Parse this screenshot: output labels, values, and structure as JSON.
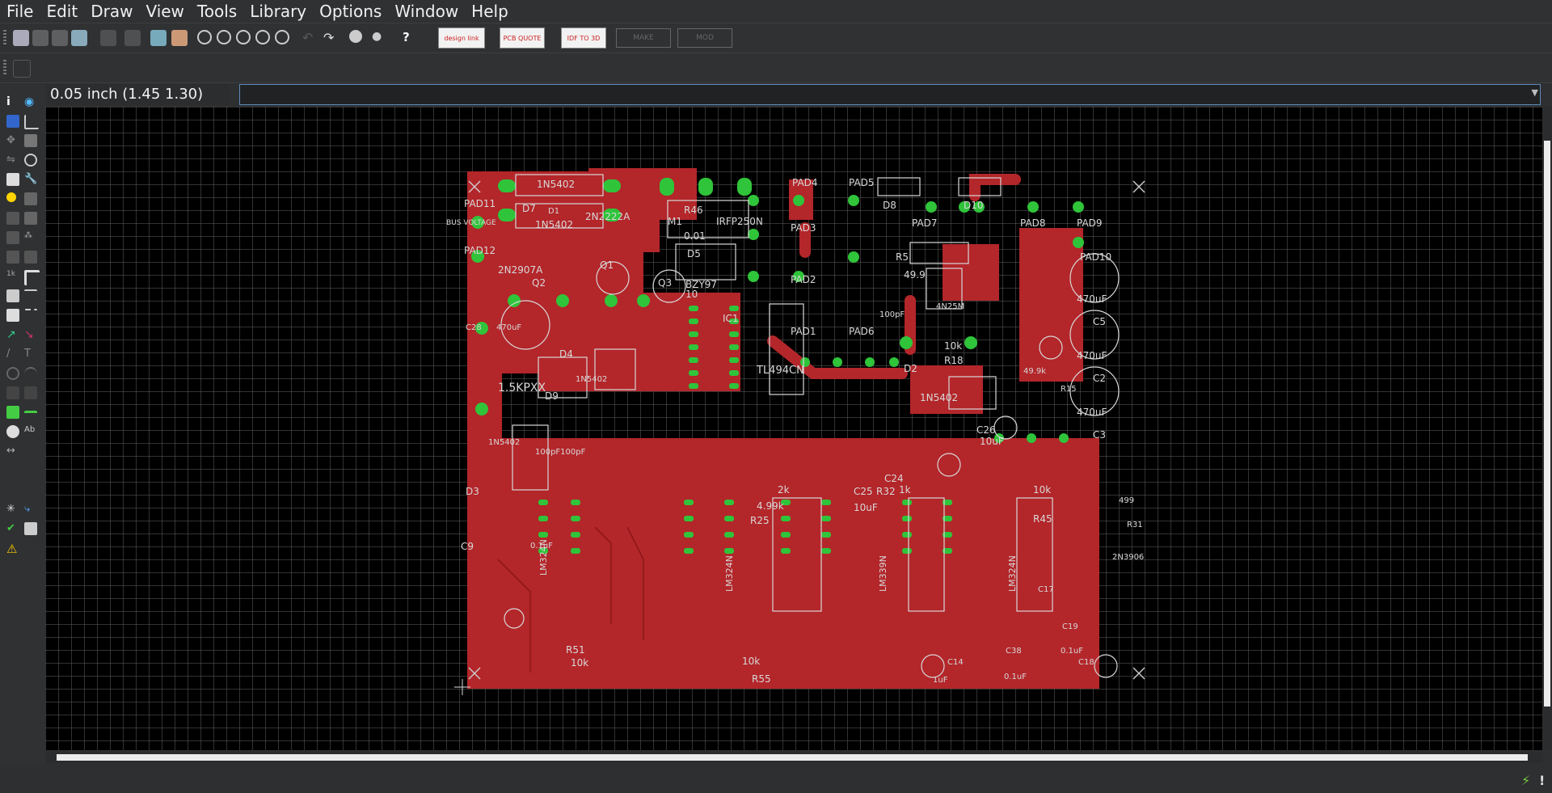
{
  "menu": [
    "File",
    "Edit",
    "Draw",
    "View",
    "Tools",
    "Library",
    "Options",
    "Window",
    "Help"
  ],
  "toolbar": {
    "design_link": "design link",
    "pcb_quote": "PCB QUOTE",
    "idf_3d": "IDF TO 3D",
    "make": "MAKE",
    "mod": "MOD"
  },
  "coord_display": "0.05 inch (1.45 1.30)",
  "command_line": {
    "value": ""
  },
  "colors": {
    "copper": "#b3262a",
    "pad": "#2fc43a",
    "grid": "#5a5a5a",
    "silkscreen": "#d8d8d8"
  },
  "pcb": {
    "labels": [
      "1N5402",
      "D1",
      "D7",
      "1N5402",
      "PAD11",
      "BUS VOLTAGE",
      "PAD12",
      "2N2907A",
      "Q2",
      "Q1",
      "2N2222A",
      "Q3",
      "M1",
      "R46",
      "IRFP250N",
      "0.01",
      "D5",
      "BZY97",
      "10",
      "PAD4",
      "PAD3",
      "PAD2",
      "PAD1",
      "PAD5",
      "PAD6",
      "D8",
      "D10",
      "PAD7",
      "PAD8",
      "PAD9",
      "PAD10",
      "R5",
      "49.9",
      "100pF",
      "4N25M",
      "IC1",
      "TL494CN",
      "470uF",
      "C5",
      "470uF",
      "C2",
      "470uF",
      "C3",
      "R15",
      "49.9k",
      "D2",
      "1N5402",
      "R18",
      "10k",
      "C28",
      "470uF",
      "1.5KPXX",
      "D4",
      "1N5402",
      "D9",
      "D3",
      "1N5402",
      "C26",
      "10uF",
      "C24",
      "C25",
      "10uF",
      "2k",
      "4.99k",
      "R25",
      "1k",
      "R32",
      "10k",
      "R45",
      "C9",
      "LM324N",
      "LM324N",
      "LM339N",
      "LM324N",
      "R51",
      "10k",
      "10k",
      "R55",
      "100pF100pF",
      "0.1uF",
      "C17",
      "C19",
      "0.1uF",
      "C18",
      "C38",
      "0.1uF",
      "C14",
      "1uF",
      "499",
      "R31",
      "2N3906"
    ]
  }
}
